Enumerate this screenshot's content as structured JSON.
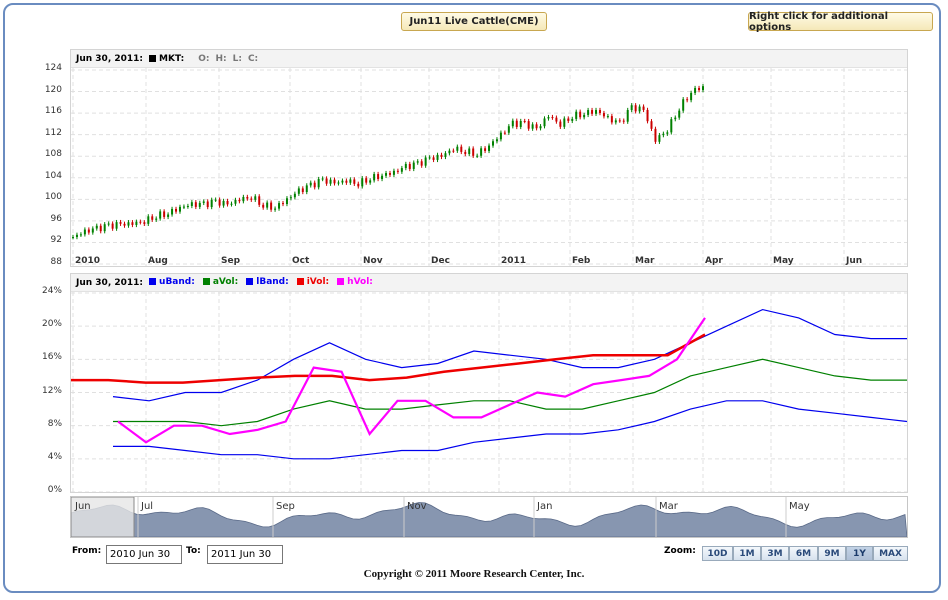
{
  "header": {
    "chart_title": "Jun11 Live Cattle(CME)",
    "options_hint": "Right click for additional options"
  },
  "price_panel": {
    "date": "Jun 30, 2011:",
    "mkt_label": "MKT:",
    "ohlc": [
      "O:",
      "H:",
      "L:",
      "C:"
    ],
    "mkt_color": "#000000"
  },
  "vol_panel": {
    "date": "Jun 30, 2011:",
    "legend": [
      {
        "label": "uBand:",
        "color": "#0000ee"
      },
      {
        "label": "aVol:",
        "color": "#008000"
      },
      {
        "label": "lBand:",
        "color": "#0000ee"
      },
      {
        "label": "iVol:",
        "color": "#ee0000"
      },
      {
        "label": "hVol:",
        "color": "#ff00ff"
      }
    ]
  },
  "x_axis_labels": [
    "2010",
    "Aug",
    "Sep",
    "Oct",
    "Nov",
    "Dec",
    "2011",
    "Feb",
    "Mar",
    "Apr",
    "May",
    "Jun"
  ],
  "navigator": {
    "labels": [
      "Jun",
      "Jul",
      "Sep",
      "Nov",
      "Jan",
      "Mar",
      "May"
    ]
  },
  "controls": {
    "from_label": "From:",
    "from_value": "2010 Jun 30",
    "to_label": "To:",
    "to_value": "2011 Jun 30",
    "zoom_label": "Zoom:",
    "zoom_options": [
      "10D",
      "1M",
      "3M",
      "6M",
      "9M",
      "1Y",
      "MAX"
    ],
    "zoom_active": "1Y"
  },
  "footer": {
    "copyright": "Copyright © 2011 Moore Research Center, Inc."
  },
  "chart_data": [
    {
      "type": "candlestick",
      "title": "Jun11 Live Cattle(CME)",
      "ylim": [
        88,
        124
      ],
      "yticks": [
        88,
        92,
        96,
        100,
        104,
        108,
        112,
        116,
        120,
        124
      ],
      "x_tick_labels": [
        "2010",
        "Aug",
        "Sep",
        "Oct",
        "Nov",
        "Dec",
        "2011",
        "Feb",
        "Mar",
        "Apr",
        "May",
        "Jun"
      ],
      "grid": true,
      "up_color": "#008000",
      "down_color": "#cc0000",
      "series_closes_by_month": [
        {
          "month": "Jul 2010",
          "close": [
            93,
            94,
            94.5,
            95,
            95.3
          ]
        },
        {
          "month": "Aug 2010",
          "close": [
            95.5,
            96,
            97,
            97.5,
            98.5,
            99
          ]
        },
        {
          "month": "Sep 2010",
          "close": [
            99,
            99.5,
            99,
            100,
            100.5
          ]
        },
        {
          "month": "Oct 2010",
          "close": [
            99,
            98.5,
            100,
            101.5,
            102.5,
            103.5
          ]
        },
        {
          "month": "Nov 2010",
          "close": [
            103,
            103.5,
            103,
            104,
            104.5
          ]
        },
        {
          "month": "Dec 2010",
          "close": [
            105,
            106,
            106.5,
            107.5,
            108
          ]
        },
        {
          "month": "Jan 2011",
          "close": [
            109.5,
            109,
            108.5,
            110,
            112,
            114
          ]
        },
        {
          "month": "Feb 2011",
          "close": [
            114,
            113,
            115.5,
            114,
            115.5,
            116
          ]
        },
        {
          "month": "Mar 2011",
          "close": [
            116.5,
            115,
            114,
            117,
            116.5
          ]
        },
        {
          "month": "Apr 2011",
          "close": [
            111,
            113,
            117,
            120,
            121
          ]
        }
      ]
    },
    {
      "type": "line",
      "ylim": [
        0,
        24
      ],
      "yticks": [
        "0%",
        "4%",
        "8%",
        "12%",
        "16%",
        "20%",
        "24%"
      ],
      "grid": true,
      "x_tick_labels": [
        "2010",
        "Aug",
        "Sep",
        "Oct",
        "Nov",
        "Dec",
        "2011",
        "Feb",
        "Mar",
        "Apr",
        "May",
        "Jun"
      ],
      "series": [
        {
          "name": "uBand",
          "color": "#0000ee",
          "values": [
            11.5,
            11,
            12,
            12,
            13.5,
            16,
            18,
            16,
            15,
            15.5,
            17,
            16.5,
            16,
            15,
            15,
            16,
            18,
            20,
            22,
            21,
            19,
            18.5,
            18.5
          ]
        },
        {
          "name": "aVol",
          "color": "#008000",
          "values": [
            8.5,
            8.5,
            8.5,
            8,
            8.5,
            10,
            11,
            10,
            10,
            10.5,
            11,
            11,
            10,
            10,
            11,
            12,
            14,
            15,
            16,
            15,
            14,
            13.5,
            13.5
          ]
        },
        {
          "name": "lBand",
          "color": "#0000ee",
          "values": [
            5.5,
            5.5,
            5,
            4.5,
            4.5,
            4,
            4,
            4.5,
            5,
            5,
            6,
            6.5,
            7,
            7,
            7.5,
            8.5,
            10,
            11,
            11,
            10,
            9.5,
            9,
            8.5
          ]
        },
        {
          "name": "iVol",
          "color": "#ee0000",
          "values": [
            13.5,
            13.5,
            13.2,
            13.2,
            13.5,
            13.8,
            14,
            14,
            13.5,
            13.8,
            14.5,
            15,
            15.5,
            16,
            16.5,
            16.5,
            16.5,
            19
          ]
        },
        {
          "name": "hVol",
          "color": "#ff00ff",
          "values": [
            8.5,
            6,
            8,
            8,
            7,
            7.5,
            8.5,
            15,
            14.5,
            7,
            11,
            11,
            9,
            9,
            10.5,
            12,
            11.5,
            13,
            13.5,
            14,
            16,
            21
          ]
        }
      ]
    }
  ]
}
